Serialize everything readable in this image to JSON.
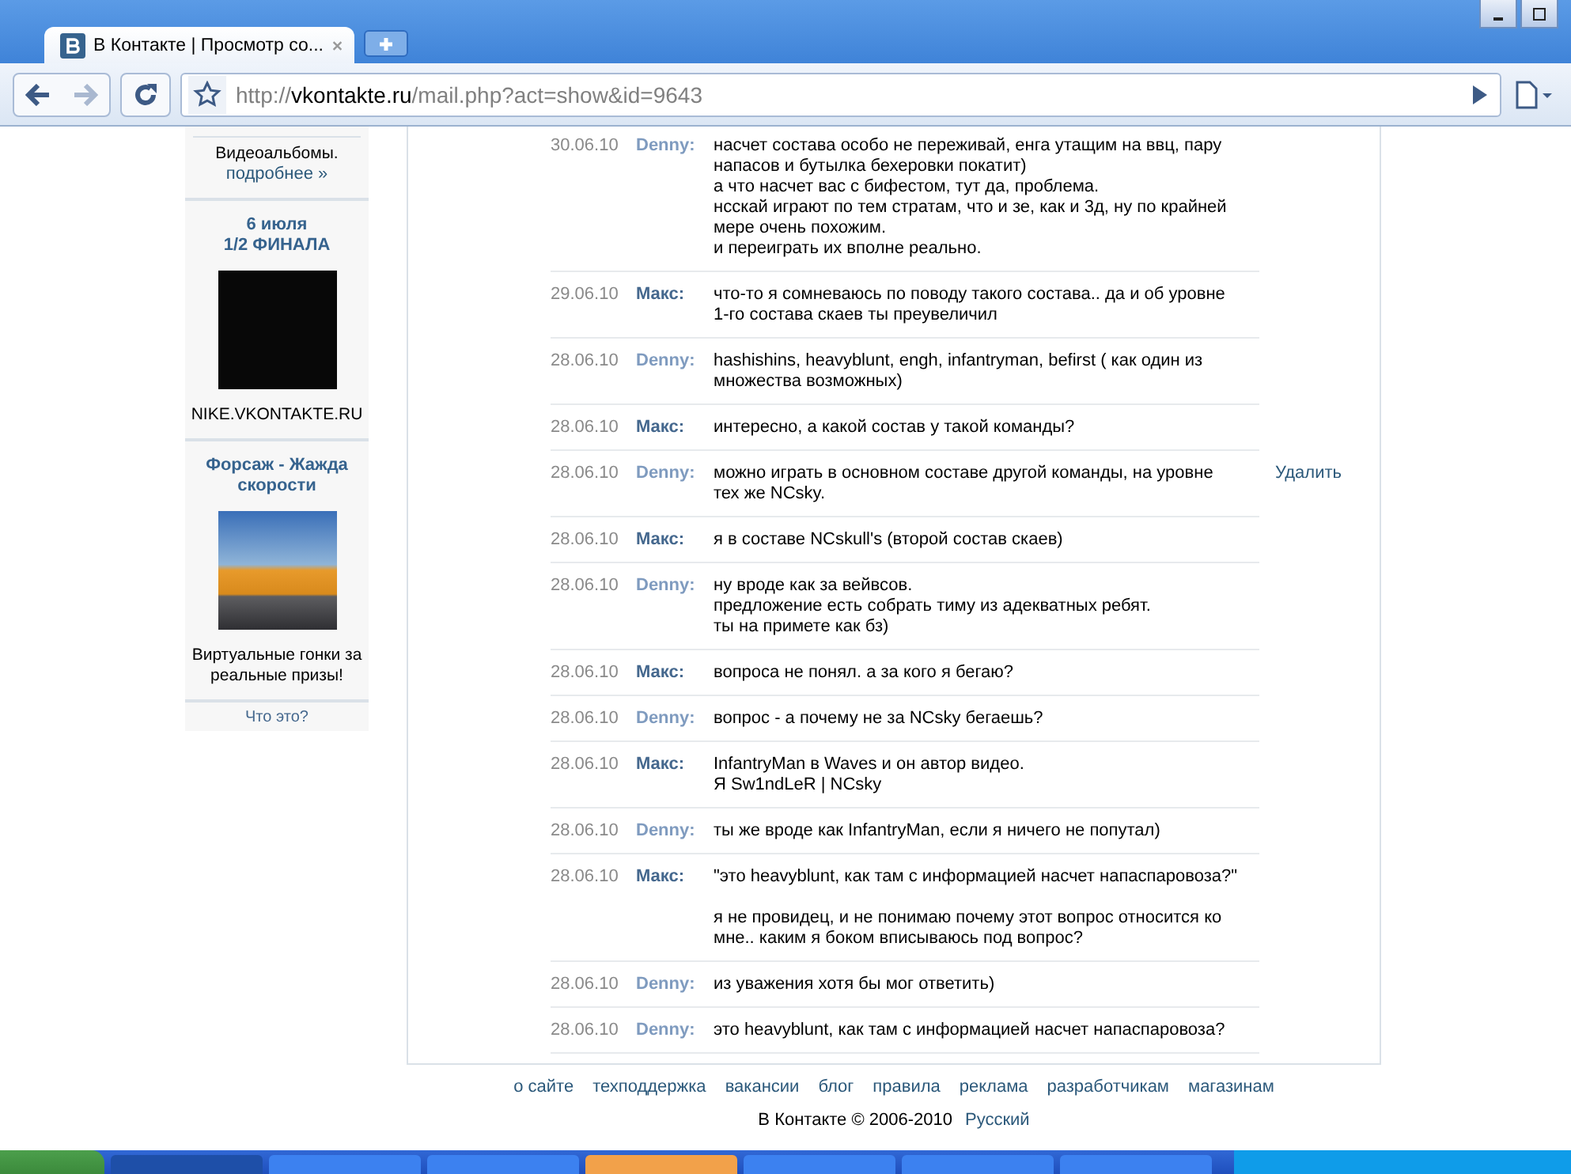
{
  "browser": {
    "tab_title": "В Контакте | Просмотр со...",
    "url": {
      "scheme": "http://",
      "host": "vkontakte.ru",
      "path": "/mail.php?act=show&id=9643"
    }
  },
  "sidebar": {
    "blocks": [
      {
        "kind": "text",
        "lines": [
          "Видеоальбомы."
        ],
        "link": "подробнее »"
      },
      {
        "kind": "ad",
        "title_lines": [
          "6 июля",
          "1/2 ФИНАЛА"
        ],
        "caption_lines": [
          "NIKE.VKONTAKTE.RU"
        ]
      },
      {
        "kind": "ad",
        "title_lines": [
          "Форсаж - Жажда",
          "скорости"
        ],
        "caption_lines": [
          "Виртуальные гонки за",
          "реальные призы!"
        ]
      }
    ],
    "footer_link": "Что это?"
  },
  "messages": [
    {
      "date": "30.06.10",
      "author": "Denny:",
      "color": "#7f9bbf",
      "paragraphs": [
        [
          "насчет состава особо не переживай, енга утащим на ввц, пару",
          "напасов и бутылка бехеровки покатит)",
          "а что насчет вас с бифестом, тут да, проблема.",
          "нсскай играют по тем стратам, что и зе, как и 3д, ну по крайней",
          "мере очень похожим.",
          "и переиграть их вполне реально."
        ]
      ]
    },
    {
      "date": "29.06.10",
      "author": "Макс:",
      "color": "#45688e",
      "paragraphs": [
        [
          "что-то я сомневаюсь по поводу такого состава.. да и об уровне",
          "1-го состава скаев ты преувеличил"
        ]
      ]
    },
    {
      "date": "28.06.10",
      "author": "Denny:",
      "color": "#7f9bbf",
      "paragraphs": [
        [
          "hashishins, heavyblunt, engh, infantryman, befirst ( как один из",
          "множества возможных)"
        ]
      ]
    },
    {
      "date": "28.06.10",
      "author": "Макс:",
      "color": "#45688e",
      "paragraphs": [
        [
          "интересно, а какой состав у такой команды?"
        ]
      ]
    },
    {
      "date": "28.06.10",
      "author": "Denny:",
      "color": "#7f9bbf",
      "paragraphs": [
        [
          "можно играть в основном составе другой команды, на уровне",
          "тех же NCsky."
        ]
      ],
      "action": "Удалить"
    },
    {
      "date": "28.06.10",
      "author": "Макс:",
      "color": "#45688e",
      "paragraphs": [
        [
          "я в составе NCskull's (второй состав скаев)"
        ]
      ]
    },
    {
      "date": "28.06.10",
      "author": "Denny:",
      "color": "#7f9bbf",
      "paragraphs": [
        [
          "ну вроде как за вейвсов.",
          "предложение есть собрать тиму из адекватных ребят.",
          "ты на примете как бз)"
        ]
      ]
    },
    {
      "date": "28.06.10",
      "author": "Макс:",
      "color": "#45688e",
      "paragraphs": [
        [
          "вопроса не понял. а за кого я бегаю?"
        ]
      ]
    },
    {
      "date": "28.06.10",
      "author": "Denny:",
      "color": "#7f9bbf",
      "paragraphs": [
        [
          "вопрос - а почему не за NCsky бегаешь?"
        ]
      ]
    },
    {
      "date": "28.06.10",
      "author": "Макс:",
      "color": "#45688e",
      "paragraphs": [
        [
          "InfantryMan в Waves и он автор видео.",
          "Я Sw1ndLeR | NCsky"
        ]
      ]
    },
    {
      "date": "28.06.10",
      "author": "Denny:",
      "color": "#7f9bbf",
      "paragraphs": [
        [
          "ты же вроде как InfantryMan, если я ничего не попутал)"
        ]
      ]
    },
    {
      "date": "28.06.10",
      "author": "Макс:",
      "color": "#45688e",
      "paragraphs": [
        [
          "\"это heavyblunt, как там с информацией насчет напаспаровоза?\""
        ],
        [
          "я не провидец, и не понимаю почему этот вопрос относится ко",
          "мне.. каким я боком вписываюсь под вопрос?"
        ]
      ]
    },
    {
      "date": "28.06.10",
      "author": "Denny:",
      "color": "#7f9bbf",
      "paragraphs": [
        [
          "из уважения хотя бы мог ответить)"
        ]
      ]
    },
    {
      "date": "28.06.10",
      "author": "Denny:",
      "color": "#7f9bbf",
      "paragraphs": [
        [
          "это heavyblunt, как там с информацией насчет напаспаровоза?"
        ]
      ]
    }
  ],
  "footer": {
    "links": [
      "о сайте",
      "техподдержка",
      "вакансии",
      "блог",
      "правила",
      "реклама",
      "разработчикам",
      "магазинам"
    ],
    "copyright": "В Контакте © 2006-2010",
    "language": "Русский"
  }
}
